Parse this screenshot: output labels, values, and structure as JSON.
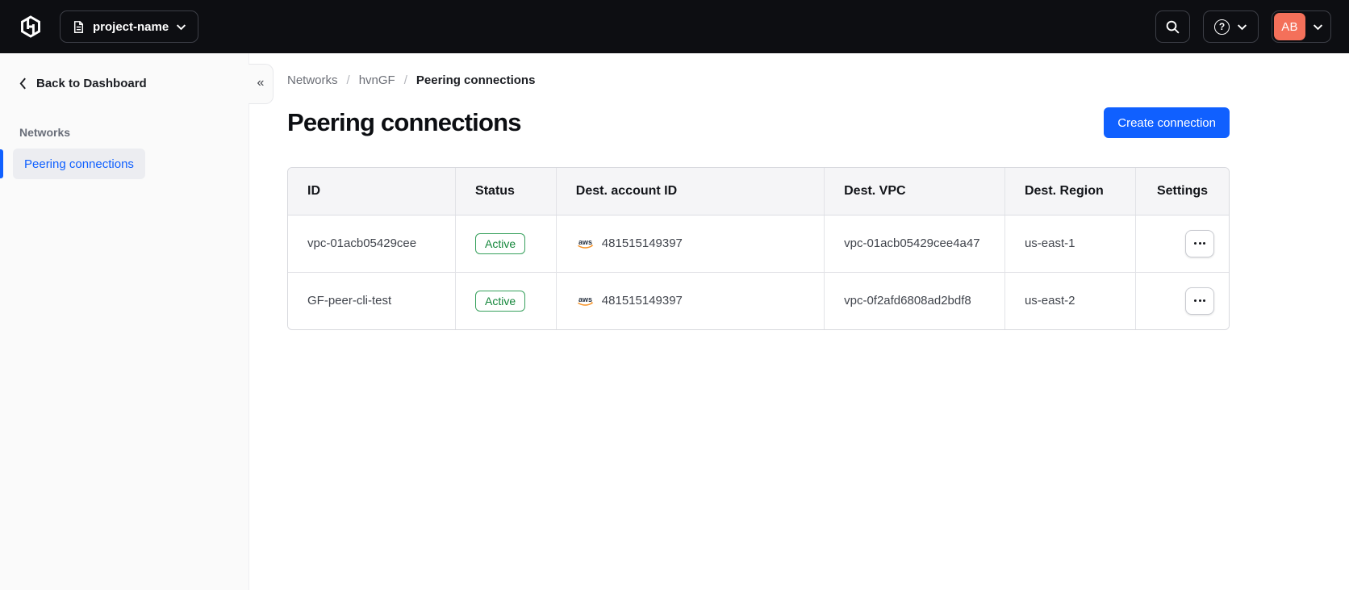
{
  "colors": {
    "accent": "#1060ff",
    "navbar-bg": "#0d0e12",
    "success": "#13863a",
    "avatar-bg": "#f4705a",
    "sidebar-bg": "#fafafa"
  },
  "navbar": {
    "project_switcher": {
      "label": "project-name"
    },
    "avatar_initials": "AB",
    "help_glyph": "?"
  },
  "sidebar": {
    "back_label": "Back to Dashboard",
    "section_label": "Networks",
    "collapse_glyph": "«",
    "items": [
      {
        "label": "Peering connections",
        "active": true
      }
    ]
  },
  "breadcrumb": {
    "separator": "/",
    "items": [
      "Networks",
      "hvnGF",
      "Peering connections"
    ]
  },
  "page": {
    "title": "Peering connections",
    "create_button_label": "Create connection"
  },
  "table": {
    "columns": [
      "ID",
      "Status",
      "Dest. account ID",
      "Dest. VPC",
      "Dest. Region",
      "Settings"
    ],
    "rows": [
      {
        "id": "vpc-01acb05429cee",
        "status": "Active",
        "dest_account_provider": "aws",
        "dest_account_id": "481515149397",
        "dest_vpc": "vpc-01acb05429cee4a47",
        "dest_region": "us-east-1"
      },
      {
        "id": "GF-peer-cli-test",
        "status": "Active",
        "dest_account_provider": "aws",
        "dest_account_id": "481515149397",
        "dest_vpc": "vpc-0f2afd6808ad2bdf8",
        "dest_region": "us-east-2"
      }
    ]
  }
}
